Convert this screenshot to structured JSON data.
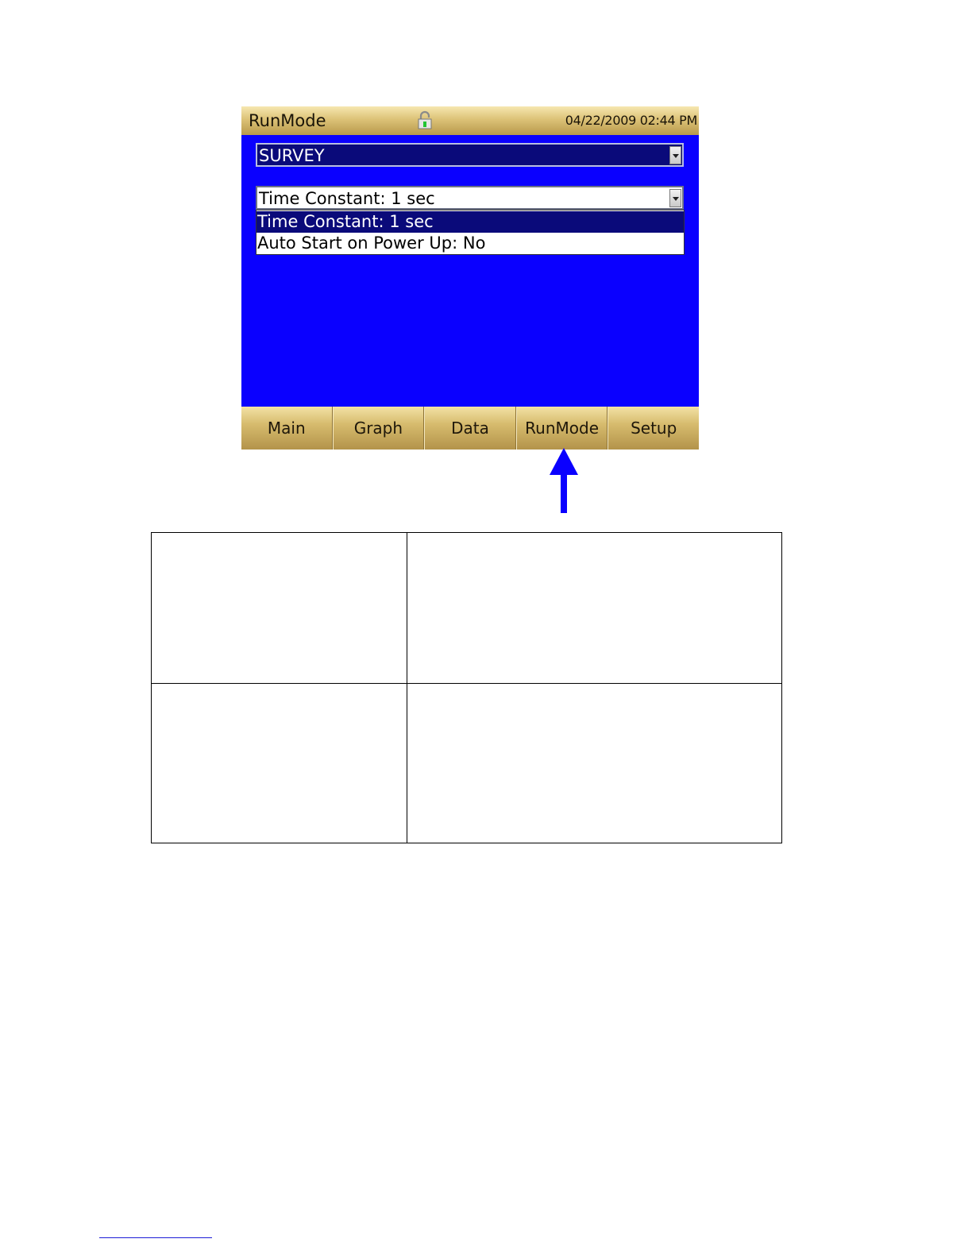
{
  "window": {
    "title": "RunMode",
    "datetime": "04/22/2009 02:44 PM",
    "lock_icon": "lock-icon"
  },
  "mode_select": {
    "value": "SURVEY"
  },
  "setting_select": {
    "value": "Time Constant: 1 sec",
    "options": [
      "Time Constant: 1 sec",
      "Auto Start on Power Up: No"
    ],
    "selected_index": 0
  },
  "tabs": [
    {
      "label": "Main"
    },
    {
      "label": "Graph"
    },
    {
      "label": "Data"
    },
    {
      "label": "RunMode"
    },
    {
      "label": "Setup"
    }
  ],
  "colors": {
    "screen_background": "#0a00ff",
    "selection": "#0a0a7a",
    "bezel_gold": "#d7bc6e",
    "arrow": "#0a00ff"
  },
  "annotation": {
    "arrow_icon": "up-arrow-icon"
  }
}
